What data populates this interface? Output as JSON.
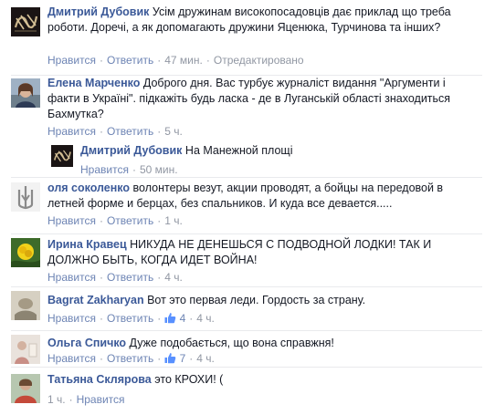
{
  "comments": [
    {
      "name": "Дмитрий Дубовик",
      "text": "Усім дружинам високопосадовців дає приклад що треба роботи. Доречі, а як допомагають дружини Яценюка, Турчинова та інших?",
      "like_label": "Нравится",
      "reply_label": "Ответить",
      "time": "47 мин.",
      "edited": "Отредактировано"
    },
    {
      "name": "Елена Марченко",
      "text": "Доброго дня. Вас турбує журналіст видання \"Аргументи і факти в Україні\". підкажіть будь ласка - де в Луганській області знаходиться Бахмутка?",
      "like_label": "Нравится",
      "reply_label": "Ответить",
      "time": "5 ч."
    },
    {
      "name": "Дмитрий Дубовик",
      "text": "На Манежной площі",
      "like_label": "Нравится",
      "time": "50 мин."
    },
    {
      "name": "оля соколенко",
      "text": "волонтеры везут, акции проводят, а бойцы на передовой в летней форме и берцах, без спальников. И куда все девается.....",
      "like_label": "Нравится",
      "reply_label": "Ответить",
      "time": "1 ч."
    },
    {
      "name": "Ирина Кравец",
      "text": "НИКУДА НЕ ДЕНЕШЬСЯ С ПОДВОДНОЙ ЛОДКИ! ТАК И ДОЛЖНО БЫТЬ, КОГДА ИДЕТ ВОЙНА!",
      "like_label": "Нравится",
      "reply_label": "Ответить",
      "time": "4 ч."
    },
    {
      "name": "Bagrat Zakharyan",
      "text": "Вот это первая леди. Гордость за страну.",
      "like_label": "Нравится",
      "reply_label": "Ответить",
      "likes": "4",
      "time": "4 ч."
    },
    {
      "name": "Ольга Спичко",
      "text": "Дуже подобається, що вона справжня!",
      "like_label": "Нравится",
      "reply_label": "Ответить",
      "likes": "7",
      "time": "4 ч."
    },
    {
      "name": "Татьяна Склярова",
      "text": "это КРОХИ! (",
      "time": "1 ч.",
      "like_label": "Нравится"
    }
  ],
  "colors": {
    "name": "#3b5998",
    "link": "#6d84b4",
    "meta": "#9197a3",
    "text": "#141823",
    "separator": "#e9eaed"
  },
  "icons": {
    "like": "thumbs-up-icon"
  }
}
